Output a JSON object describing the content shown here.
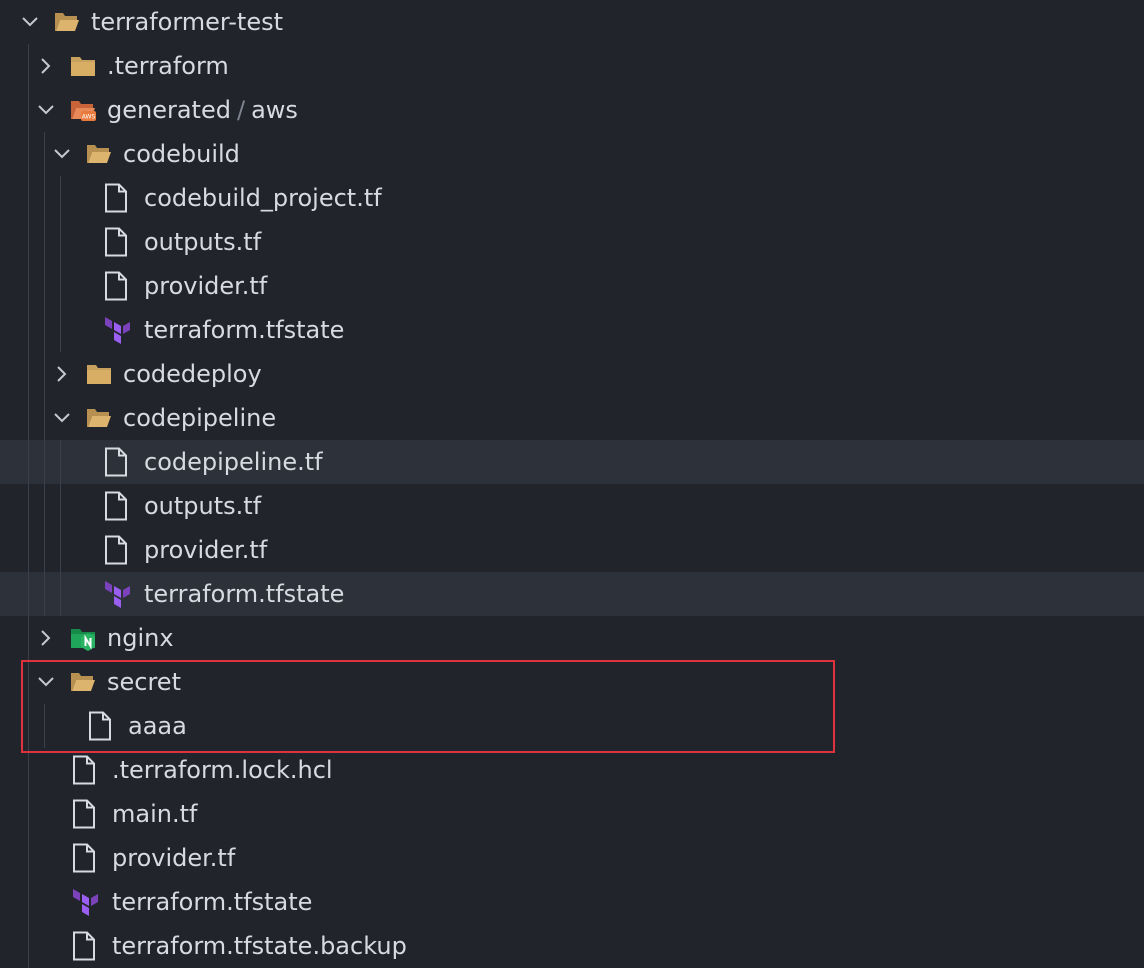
{
  "tree": {
    "root": "terraformer-test",
    "terraform_dir": ".terraform",
    "generated_dir": "generated",
    "generated_sep": "/",
    "aws_dir": "aws",
    "codebuild": {
      "name": "codebuild",
      "files": [
        "codebuild_project.tf",
        "outputs.tf",
        "provider.tf",
        "terraform.tfstate"
      ]
    },
    "codedeploy": {
      "name": "codedeploy"
    },
    "codepipeline": {
      "name": "codepipeline",
      "files": [
        "codepipeline.tf",
        "outputs.tf",
        "provider.tf",
        "terraform.tfstate"
      ]
    },
    "nginx": {
      "name": "nginx"
    },
    "secret": {
      "name": "secret",
      "files": [
        "aaaa"
      ]
    },
    "root_files": [
      ".terraform.lock.hcl",
      "main.tf",
      "provider.tf",
      "terraform.tfstate",
      "terraform.tfstate.backup"
    ]
  },
  "icons": {
    "folder": "folder-icon",
    "folder_open": "folder-open-icon",
    "aws_folder": "aws-folder-icon",
    "nginx_folder": "nginx-folder-icon",
    "file": "file-icon",
    "terraform": "terraform-icon"
  },
  "colors": {
    "background": "#21252b",
    "row_highlight": "#2c313a",
    "text": "#d7dae0",
    "folder": "#c8a15e",
    "aws": "#ea7a3c",
    "nginx": "#1fa65a",
    "terraform": "#7b42bc",
    "annotation_border": "#e0313f"
  }
}
